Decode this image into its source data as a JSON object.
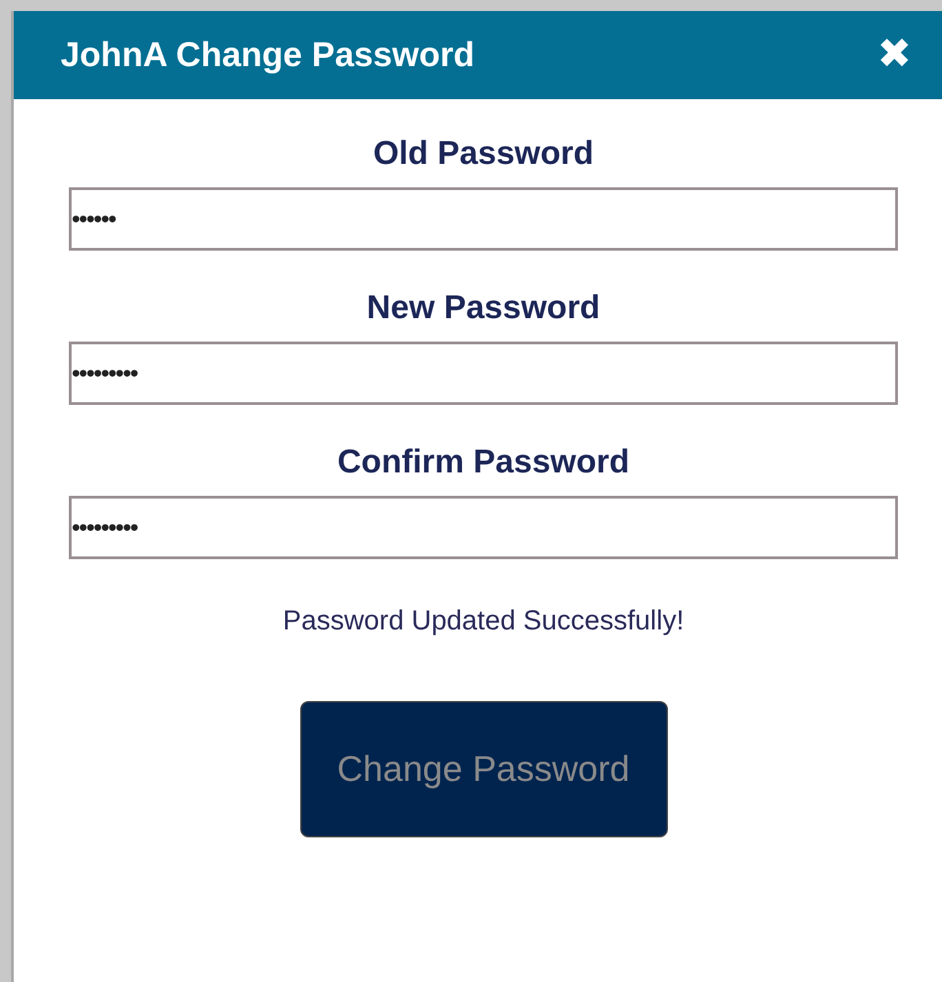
{
  "dialog": {
    "title": "JohnA Change Password",
    "close_icon": "✖"
  },
  "fields": [
    {
      "label": "Old Password",
      "value": "••••••"
    },
    {
      "label": "New Password",
      "value": "•••••••••"
    },
    {
      "label": "Confirm Password",
      "value": "•••••••••"
    }
  ],
  "message": "Password Updated Successfully!",
  "button": {
    "label": "Change Password",
    "disabled": true
  }
}
